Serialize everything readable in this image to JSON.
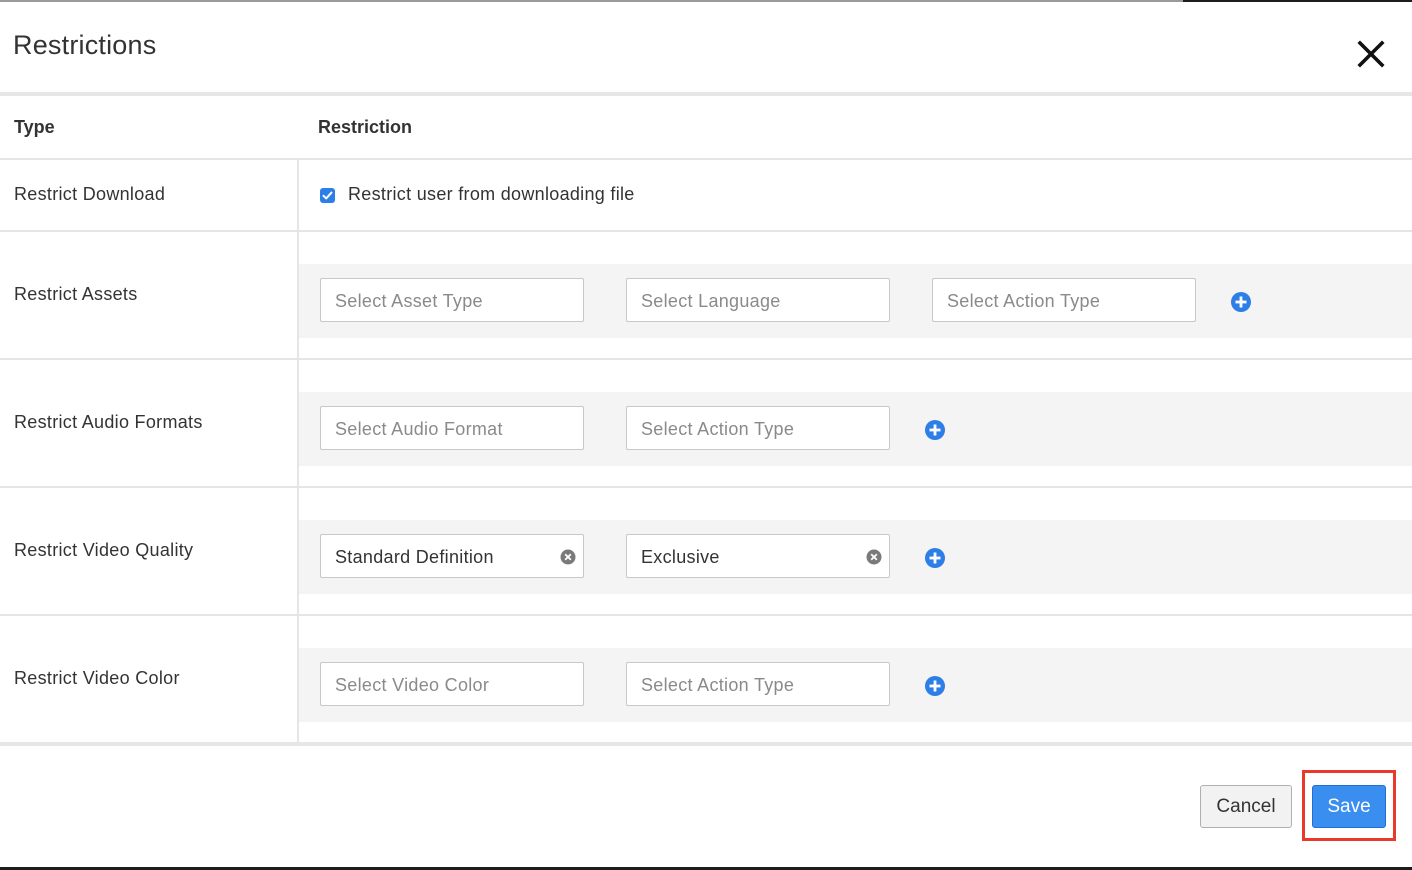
{
  "modal": {
    "title": "Restrictions"
  },
  "table": {
    "headers": {
      "type": "Type",
      "restriction": "Restriction"
    },
    "rows": [
      {
        "label": "Restrict Download",
        "checkbox": {
          "checked": true,
          "label": "Restrict user from downloading file"
        }
      },
      {
        "label": "Restrict Assets",
        "selects": [
          {
            "placeholder": "Select Asset Type",
            "value": ""
          },
          {
            "placeholder": "Select Language",
            "value": ""
          },
          {
            "placeholder": "Select Action Type",
            "value": ""
          }
        ]
      },
      {
        "label": "Restrict Audio Formats",
        "selects": [
          {
            "placeholder": "Select Audio Format",
            "value": ""
          },
          {
            "placeholder": "Select Action Type",
            "value": ""
          }
        ]
      },
      {
        "label": "Restrict Video Quality",
        "selects": [
          {
            "placeholder": "",
            "value": "Standard Definition"
          },
          {
            "placeholder": "",
            "value": "Exclusive"
          }
        ]
      },
      {
        "label": "Restrict Video Color",
        "selects": [
          {
            "placeholder": "Select Video Color",
            "value": ""
          },
          {
            "placeholder": "Select Action Type",
            "value": ""
          }
        ]
      }
    ]
  },
  "footer": {
    "cancel_label": "Cancel",
    "save_label": "Save"
  },
  "icons": {
    "close": "close-icon",
    "add": "plus-circle-icon",
    "clear": "clear-circle-icon",
    "check": "checkmark-icon"
  },
  "colors": {
    "accent": "#3a8ef0",
    "highlight": "#e8392a",
    "band": "#f4f4f4"
  }
}
